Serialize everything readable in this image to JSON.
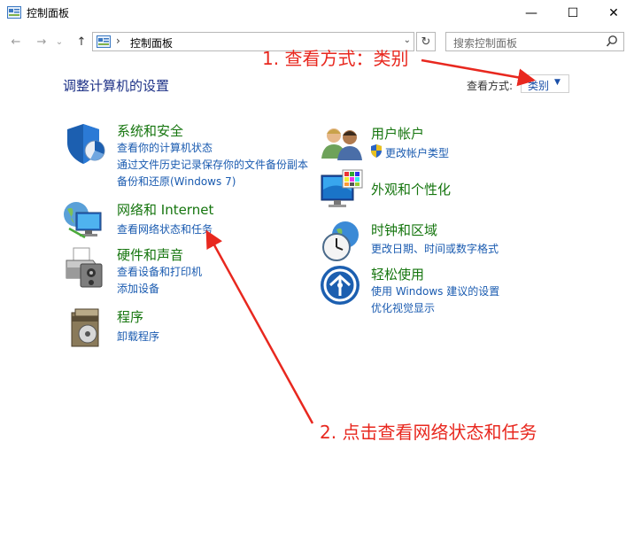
{
  "window": {
    "title": "控制面板",
    "minimize": "—",
    "maximize": "☐",
    "close": "✕"
  },
  "nav": {
    "back": "←",
    "forward": "→",
    "recent": "⌄",
    "up": "↑",
    "address": "控制面板",
    "address_sep": "›",
    "address_drop": "⌄",
    "refresh": "↻",
    "search_placeholder": "搜索控制面板"
  },
  "main": {
    "heading": "调整计算机的设置",
    "view_by_label": "查看方式:",
    "view_by_value": "类别"
  },
  "categories_left": [
    {
      "title": "系统和安全",
      "links": [
        "查看你的计算机状态",
        "通过文件历史记录保存你的文件备份副本",
        "备份和还原(Windows 7)"
      ],
      "icon": "shield-icon"
    },
    {
      "title": "网络和 Internet",
      "links": [
        "查看网络状态和任务"
      ],
      "icon": "network-icon"
    },
    {
      "title": "硬件和声音",
      "links": [
        "查看设备和打印机",
        "添加设备"
      ],
      "icon": "printer-icon"
    },
    {
      "title": "程序",
      "links": [
        "卸载程序"
      ],
      "icon": "programs-icon"
    }
  ],
  "categories_right": [
    {
      "title": "用户帐户",
      "links": [
        "更改帐户类型"
      ],
      "icon": "users-icon"
    },
    {
      "title": "外观和个性化",
      "links": [],
      "icon": "appearance-icon"
    },
    {
      "title": "时钟和区域",
      "links": [
        "更改日期、时间或数字格式"
      ],
      "icon": "clock-icon"
    },
    {
      "title": "轻松使用",
      "links": [
        "使用 Windows 建议的设置",
        "优化视觉显示"
      ],
      "icon": "ease-of-access-icon"
    }
  ],
  "annotations": {
    "step1": "1. 查看方式：类别",
    "step2": "2. 点击查看网络状态和任务",
    "color": "#e8281f"
  }
}
